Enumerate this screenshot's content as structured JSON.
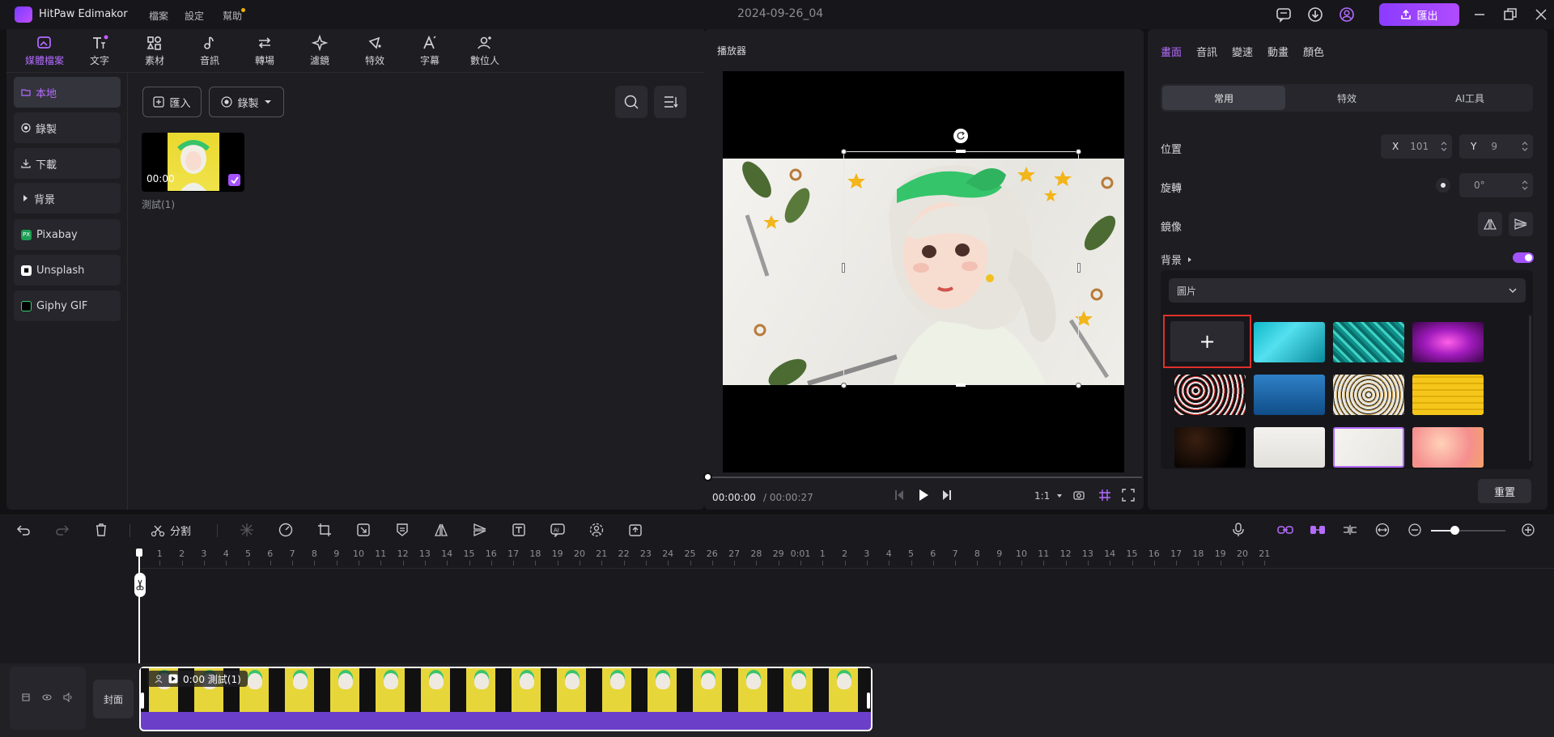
{
  "app": {
    "name": "HitPaw Edimakor",
    "project_title": "2024-09-26_04"
  },
  "menu": [
    "檔案",
    "設定",
    "幫助"
  ],
  "export_label": "匯出",
  "tools": [
    {
      "label": "媒體檔案",
      "icon": "media-icon"
    },
    {
      "label": "文字",
      "icon": "text-icon"
    },
    {
      "label": "素材",
      "icon": "elements-icon"
    },
    {
      "label": "音訊",
      "icon": "audio-icon"
    },
    {
      "label": "轉場",
      "icon": "transition-icon"
    },
    {
      "label": "濾鏡",
      "icon": "filter-icon"
    },
    {
      "label": "特效",
      "icon": "effects-icon"
    },
    {
      "label": "字幕",
      "icon": "subtitle-icon"
    },
    {
      "label": "數位人",
      "icon": "avatar-icon"
    }
  ],
  "sidebar": [
    "本地",
    "錄製",
    "下載",
    "背景",
    "Pixabay",
    "Unsplash",
    "Giphy GIF"
  ],
  "media": {
    "import_label": "匯入",
    "record_label": "錄製",
    "item": {
      "duration": "00:00",
      "name": "測試(1)"
    }
  },
  "player": {
    "title": "播放器",
    "current_time": "00:00:00",
    "total_time": "/ 00:00:27",
    "ratio": "1:1"
  },
  "properties": {
    "tabs": [
      "畫面",
      "音訊",
      "變速",
      "動畫",
      "顏色"
    ],
    "subtabs": [
      "常用",
      "特效",
      "AI工具"
    ],
    "position_label": "位置",
    "x_label": "X",
    "x_value": "101",
    "y_label": "Y",
    "y_value": "9",
    "rotation_label": "旋轉",
    "rotation_value": "0°",
    "mirror_label": "鏡像",
    "background_label": "背景",
    "background_type": "圖片",
    "background_enabled": true,
    "reset_label": "重置"
  },
  "timeline": {
    "split_label": "分割",
    "cover_label": "封面",
    "clip_label": "0:00 測試(1)",
    "ruler_a": [
      "1",
      "2",
      "3",
      "4",
      "5",
      "6",
      "7",
      "8",
      "9",
      "10",
      "11",
      "12",
      "13",
      "14",
      "15",
      "16",
      "17",
      "18",
      "19",
      "20",
      "21",
      "22",
      "23",
      "24",
      "25",
      "26",
      "27",
      "28",
      "29"
    ],
    "ruler_mid": "0:01",
    "ruler_b": [
      "1",
      "2",
      "3",
      "4",
      "5",
      "6",
      "7",
      "8",
      "9",
      "10",
      "11",
      "12",
      "13",
      "14",
      "15",
      "16",
      "17",
      "18",
      "19",
      "20",
      "21"
    ]
  }
}
